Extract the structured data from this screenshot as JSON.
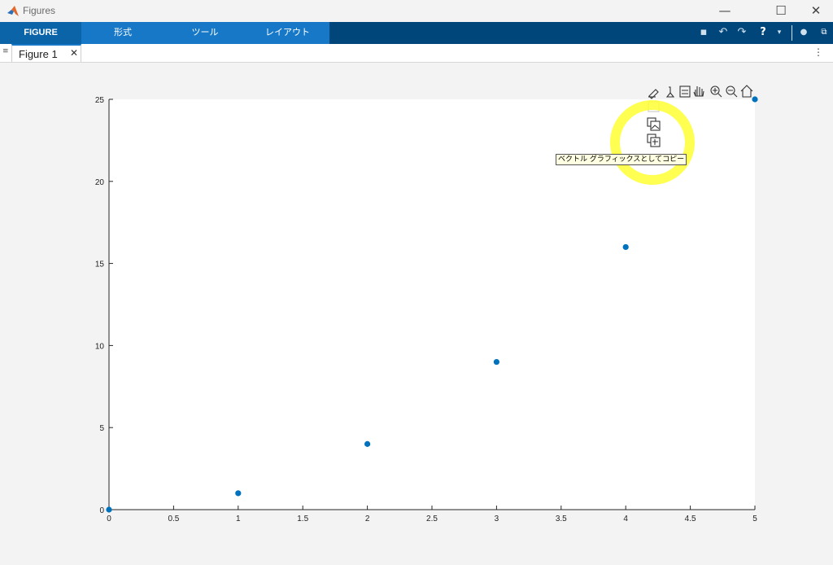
{
  "window": {
    "title": "Figures",
    "minimize": "—",
    "maximize": "☐",
    "close": "✕"
  },
  "ribbon": {
    "tabs": [
      "FIGURE",
      "形式",
      "ツール",
      "レイアウト"
    ],
    "active_tab": "FIGURE"
  },
  "document_tab": {
    "label": "Figure 1",
    "close": "✕"
  },
  "axes_toolbar": {
    "icons": [
      "brush-icon",
      "data-tips-icon",
      "legend-icon",
      "pan-icon",
      "zoom-in-icon",
      "zoom-out-icon",
      "home-icon"
    ],
    "export_menu": [
      "save-icon",
      "copy-image-icon",
      "copy-vector-icon"
    ],
    "tooltip": "ベクトル グラフィックスとしてコピー"
  },
  "highlight": {
    "color": "#ffff33",
    "shape": "ring"
  },
  "chart_data": {
    "type": "scatter",
    "x": [
      0,
      1,
      2,
      3,
      4,
      5
    ],
    "y": [
      0,
      1,
      4,
      9,
      16,
      25
    ],
    "xlim": [
      0,
      5
    ],
    "ylim": [
      0,
      25
    ],
    "xticks": [
      "0",
      "0.5",
      "1",
      "1.5",
      "2",
      "2.5",
      "3",
      "3.5",
      "4",
      "4.5",
      "5"
    ],
    "yticks": [
      "0",
      "5",
      "10",
      "15",
      "20",
      "25"
    ],
    "xlabel": "",
    "ylabel": "",
    "title": "",
    "grid": false,
    "marker_color": "#0072bd"
  },
  "colors": {
    "ribbon_dark": "#00467a",
    "ribbon_tabs": "#1678c6",
    "marker": "#0072bd"
  }
}
